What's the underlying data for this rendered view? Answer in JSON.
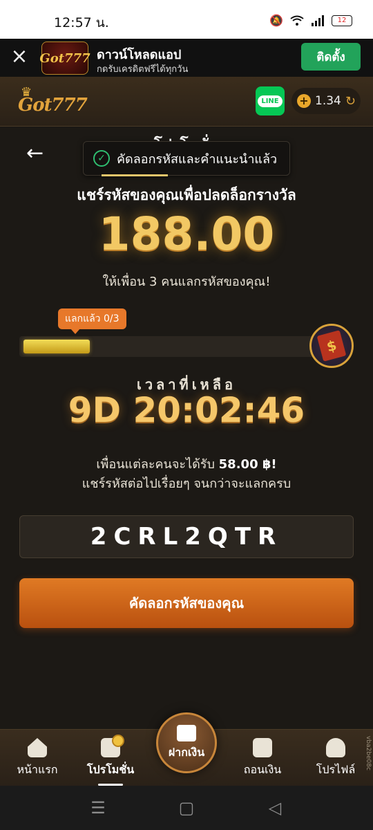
{
  "status_bar": {
    "time": "12:57 น.",
    "battery": "12"
  },
  "download_banner": {
    "logo_text": "Got777",
    "title": "ดาวน์โหลดแอป",
    "subtitle": "กดรับเครดิตฟรีได้ทุกวัน",
    "install_label": "ติดตั้ง"
  },
  "header": {
    "brand": "Got777",
    "line_label": "LINE",
    "balance": "1.34"
  },
  "main": {
    "title_partial": "โปรโมชั่น",
    "toast": "คัดลอกรหัสและคำแนะนำแล้ว",
    "share_heading": "แชร์รหัสของคุณเพื่อปลดล็อกรางวัล",
    "amount": "188.00",
    "invite_text": "ให้เพื่อน 3 คนแลกรหัสของคุณ!",
    "progress_label": "แลกแล้ว 0/3",
    "progress_fraction": 0.22,
    "time_label": "เวลาที่เหลือ",
    "countdown": "9D 20:02:46",
    "reward_prefix": "เพื่อนแต่ละคนจะได้รับ",
    "reward_amount": "58.00 ฿!",
    "continue_text": "แชร์รหัสต่อไปเรื่อยๆ จนกว่าจะแลกครบ",
    "code": "2CRL2QTR",
    "copy_button": "คัดลอกรหัสของคุณ"
  },
  "bottom_nav": {
    "home": "หน้าแรก",
    "promotion": "โปรโมชั่น",
    "deposit": "ฝากเงิน",
    "withdraw": "ถอนเงิน",
    "profile": "โปรไฟล์"
  },
  "watermark": "vba2be08c",
  "colors": {
    "accent": "#e07a24",
    "gold": "#f2c864",
    "install_green": "#22a35a",
    "line_green": "#06c755"
  }
}
